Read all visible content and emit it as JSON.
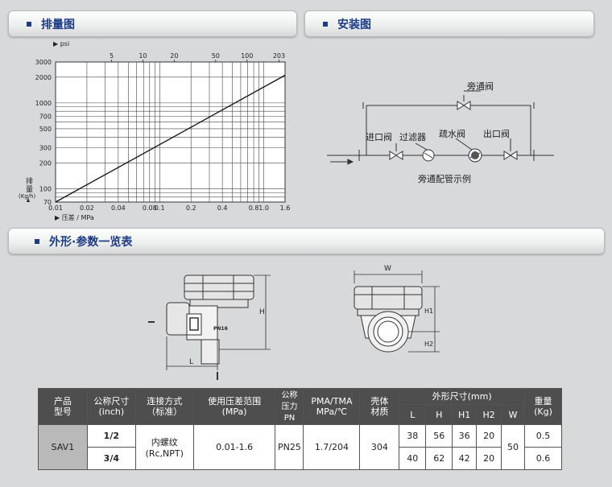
{
  "sections": {
    "flow_chart": "排量图",
    "installation": "安装图",
    "dimensions": "外形·参数一览表"
  },
  "chart_data": {
    "type": "line",
    "title": "",
    "xlabel": "▶ 压差 / MPa",
    "ylabel": "排量 (Kg/h)",
    "x_scale": "log",
    "y_scale": "log",
    "xlim": [
      0.01,
      1.6
    ],
    "ylim": [
      70,
      3000
    ],
    "x_ticks": [
      "0.01",
      "0.02",
      "0.04",
      "0.08",
      "0.1",
      "0.2",
      "0.4",
      "0.8",
      "1.0",
      "1.6"
    ],
    "y_ticks": [
      "3000",
      "2000",
      "1000",
      "700",
      "500",
      "300",
      "200",
      "100",
      "70"
    ],
    "top_axis_label": "▶ psi",
    "top_ticks": [
      "5",
      "10",
      "20",
      "50",
      "100",
      "203"
    ],
    "grid": true,
    "series": [
      {
        "values": [
          [
            0.01,
            70
          ],
          [
            1.6,
            2100
          ]
        ]
      }
    ]
  },
  "installation": {
    "bypass_valve": "旁通阀",
    "inlet_valve": "进口阀",
    "filter": "过滤器",
    "trap": "疏水阀",
    "outlet_valve": "出口阀",
    "caption": "旁通配管示例"
  },
  "drawing": {
    "H": "H",
    "L": "L",
    "W": "W",
    "H1": "H1",
    "H2": "H2",
    "pn_mark": "PN16"
  },
  "table": {
    "headers": {
      "model": "产品\n型号",
      "size": "公称尺寸\n(inch)",
      "connection": "连接方式\n（标准）",
      "pressure_range": "使用压差范围\n(MPa)",
      "pn": "公称\n压力\nPN",
      "pma_tma": "PMA/TMA\nMPa/℃",
      "body_material": "壳体\n材质",
      "dims": "外形尺寸(mm)",
      "L": "L",
      "H": "H",
      "H1": "H1",
      "H2": "H2",
      "W": "W",
      "weight": "重量\n(Kg)"
    },
    "model": "SAV1",
    "connection": "内螺纹\n(Rc,NPT)",
    "pressure_range": "0.01-1.6",
    "pn": "PN25",
    "pma_tma": "1.7/204",
    "body_material": "304",
    "W": "50",
    "rows": [
      {
        "size": "1/2",
        "L": "38",
        "H": "56",
        "H1": "36",
        "H2": "20",
        "weight": "0.5"
      },
      {
        "size": "3/4",
        "L": "40",
        "H": "62",
        "H1": "42",
        "H2": "20",
        "weight": "0.6"
      }
    ]
  }
}
